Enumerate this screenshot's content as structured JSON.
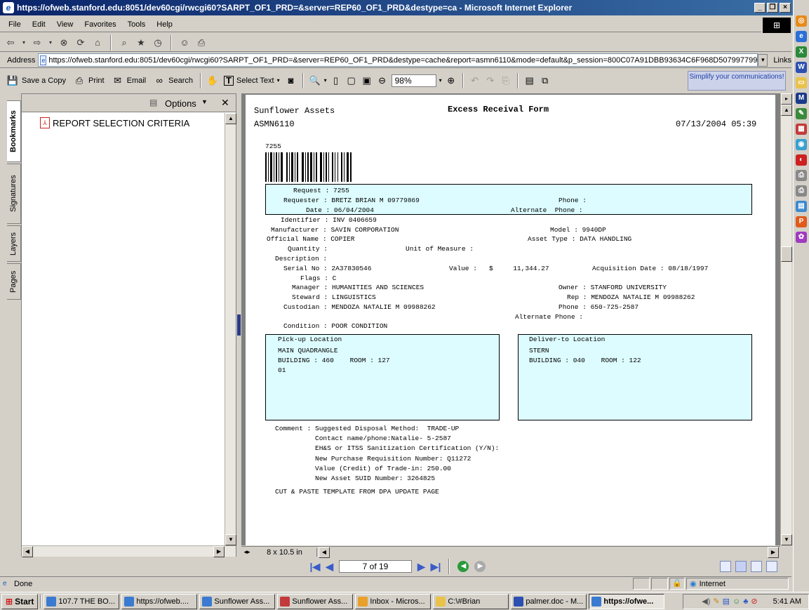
{
  "window": {
    "title": "https://ofweb.stanford.edu:8051/dev60cgi/rwcgi60?SARPT_OF1_PRD=&server=REP60_OF1_PRD&destype=ca - Microsoft Internet Explorer"
  },
  "menu": [
    "File",
    "Edit",
    "View",
    "Favorites",
    "Tools",
    "Help"
  ],
  "address": {
    "label": "Address",
    "url": "https://ofweb.stanford.edu:8051/dev60cgi/rwcgi60?SARPT_OF1_PRD=&server=REP60_OF1_PRD&destype=cache&report=asmn6110&mode=default&p_session=800C07A91DBB93634C6F968D507997799",
    "links": "Links"
  },
  "acrobat_toolbar": {
    "save": "Save a Copy",
    "print": "Print",
    "email": "Email",
    "search": "Search",
    "select_text": "Select Text",
    "zoom": "98%",
    "promo": "Simplify your communications!"
  },
  "nav_pane": {
    "tabs": [
      "Bookmarks",
      "Signatures",
      "Layers",
      "Pages"
    ],
    "options": "Options",
    "bookmark": "REPORT SELECTION CRITERIA"
  },
  "report": {
    "company": "Sunflower Assets",
    "form_title": "Excess Receival Form",
    "report_id": "ASMN6110",
    "datetime": "07/13/2004 05:39",
    "barcode_number": "7255",
    "requester_block": {
      "request": "Request : 7255",
      "requester": "Requester : BRETZ BRIAN M 09779869",
      "phone": "Phone :",
      "date": "Date : 06/04/2004",
      "alt_phone": "Alternate  Phone :"
    },
    "details": {
      "identifier": "Identifier : INV 0406659",
      "manufacturer": "Manufacturer : SAVIN CORPORATION",
      "model": "Model : 9940DP",
      "official_name": "Official Name : COPIER",
      "asset_type": "Asset Type : DATA HANDLING",
      "quantity": "Quantity :",
      "uom": "Unit of Measure :",
      "description": "Description :",
      "serial": "Serial No : 2A37830546",
      "value": "Value :   $     11,344.27",
      "acq_date": "Acquisition Date : 08/18/1997",
      "flags": "Flags : C",
      "manager": "Manager : HUMANITIES AND SCIENCES",
      "owner": "Owner : STANFORD UNIVERSITY",
      "steward": "Steward : LINGUISTICS",
      "rep": "Rep : MENDOZA NATALIE M 09988262",
      "custodian": "Custodian : MENDOZA NATALIE M 09988262",
      "phone": "Phone : 650-725-2587",
      "alt_phone": "Alternate Phone :",
      "condition": "Condition : POOR CONDITION"
    },
    "pickup": {
      "title": "Pick-up Location",
      "line1": "MAIN QUADRANGLE",
      "line2": "BUILDING : 460    ROOM : 127",
      "line3": "01"
    },
    "deliver": {
      "title": "Deliver-to Location",
      "line1": "STERN",
      "line2": "BUILDING : 040    ROOM : 122"
    },
    "comment": [
      "Comment : Suggested Disposal Method:  TRADE-UP",
      "          Contact name/phone:Natalie- 5-2587",
      "          EH&S or ITSS Sanitization Certification (Y/N):",
      "          New Purchase Requisition Number: Q11272",
      "          Value (Credit) of Trade-in: 250.00",
      "          New Asset SUID Number: 3264825"
    ],
    "footer_note": "CUT & PASTE TEMPLATE FROM DPA UPDATE PAGE"
  },
  "doc_status": {
    "page_size": "8 x 10.5 in",
    "page_indicator": "7 of 19"
  },
  "statusbar": {
    "text": "Done",
    "zone": "Internet"
  },
  "taskbar": {
    "start": "Start",
    "tasks": [
      "107.7 THE BO...",
      "https://ofweb....",
      "Sunflower Ass...",
      "Sunflower Ass...",
      "Inbox - Micros...",
      "C:\\#Brian",
      "palmer.doc - M...",
      "https://ofwe..."
    ],
    "clock": "5:41 AM"
  }
}
